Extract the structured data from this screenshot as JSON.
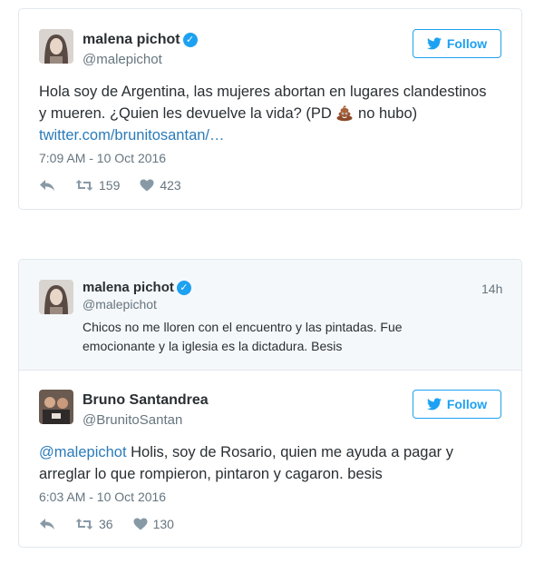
{
  "tweet1": {
    "author_name": "malena pichot",
    "author_handle": "@malepichot",
    "follow_label": "Follow",
    "text_line1": "Hola soy de Argentina, las mujeres abortan en lugares clandestinos",
    "text_line2_before_emoji": "y mueren. ¿Quien les devuelve la vida? (PD",
    "text_line2_emoji": "pile-of-poo-emoji",
    "text_line2_after_emoji": "no hubo)",
    "link": "twitter.com/brunitosantan/…",
    "timestamp": "7:09 AM - 10 Oct 2016",
    "retweets": "159",
    "likes": "423"
  },
  "tweet2": {
    "quoted": {
      "author_name": "malena pichot",
      "author_handle": "@malepichot",
      "age": "14h",
      "text_line1": "Chicos no me lloren con el encuentro y las pintadas. Fue",
      "text_line2": "emocionante y la iglesia es la dictadura. Besis"
    },
    "author_name": "Bruno Santandrea",
    "author_handle": "@BrunitoSantan",
    "follow_label": "Follow",
    "mention": "@malepichot",
    "text_line1_rest": " Holis, soy de Rosario, quien me ayuda a pagar y",
    "text_line2": "arreglar lo que rompieron, pintaron y cagaron. besis",
    "timestamp": "6:03 AM - 10 Oct 2016",
    "retweets": "36",
    "likes": "130"
  },
  "colors": {
    "twitter_blue": "#1da1f2",
    "link_blue": "#2b7bb9",
    "secondary_text": "#66757f",
    "border": "#e1e8ed",
    "quoted_bg": "#f5f8fa"
  }
}
